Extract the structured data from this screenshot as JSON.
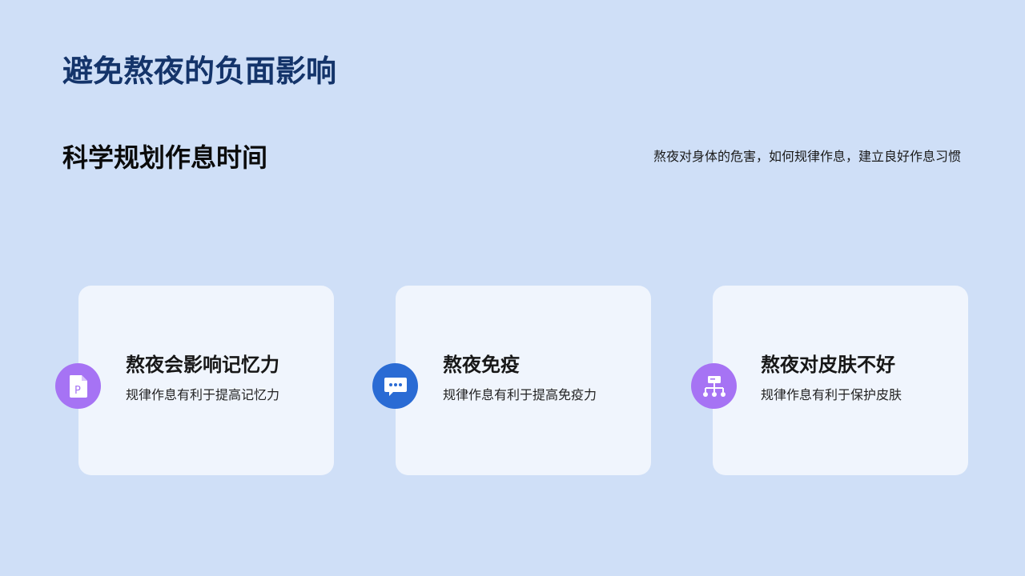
{
  "slide": {
    "title": "避免熬夜的负面影响",
    "subtitle": "科学规划作息时间",
    "summary": "熬夜对身体的危害，如何规律作息，建立良好作息习惯"
  },
  "cards": [
    {
      "heading": "熬夜会影响记忆力",
      "text": "规律作息有利于提高记忆力",
      "icon": "document-p-icon",
      "icon_letter": "P",
      "color": "#a673f4"
    },
    {
      "heading": "熬夜免疫",
      "text": "规律作息有利于提高免疫力",
      "icon": "chat-bubble-icon",
      "color": "#2a6bd4"
    },
    {
      "heading": "熬夜对皮肤不好",
      "text": "规律作息有利于保护皮肤",
      "icon": "org-chart-icon",
      "color": "#a673f4"
    }
  ],
  "colors": {
    "background": "#cfdff7",
    "card": "#f0f5fd",
    "title": "#14346a"
  }
}
